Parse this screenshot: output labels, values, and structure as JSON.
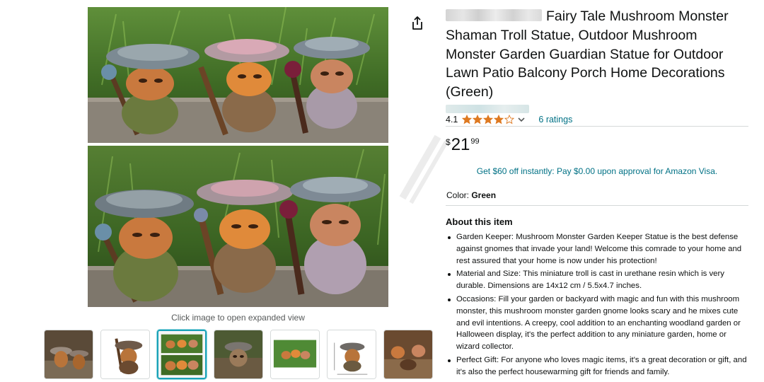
{
  "product": {
    "title": "Fairy Tale Mushroom Monster Shaman Troll Statue, Outdoor Mushroom Monster Garden Guardian Statue for Outdoor Lawn Patio Balcony Porch Home Decorations (Green)",
    "brand_redacted": true
  },
  "rating": {
    "value": "4.1",
    "stars_filled": 4.1,
    "stars_total": 5,
    "count_label": "6 ratings"
  },
  "price": {
    "symbol": "$",
    "whole": "21",
    "fraction": "99"
  },
  "promo": {
    "text": "Get $60 off instantly: Pay $0.00 upon approval for Amazon Visa."
  },
  "color": {
    "label": "Color: ",
    "value": "Green"
  },
  "about": {
    "heading": "About this item",
    "bullets": [
      "Garden Keeper: Mushroom Monster Garden Keeper Statue is the best defense against gnomes that invade your land! Welcome this comrade to your home and rest assured that your home is now under his protection!",
      "Material and Size: This miniature troll is cast in urethane resin which is very durable. Dimensions are 14x12 cm / 5.5x4.7 inches.",
      "Occasions: Fill your garden or backyard with magic and fun with this mushroom monster, this mushroom monster garden gnome looks scary and he mixes cute and evil intentions. A creepy, cool addition to an enchanting woodland garden or Halloween display, it's the perfect addition to any miniature garden, home or wizard collector.",
      "Perfect Gift: For anyone who loves magic items, it's a great decoration or gift, and it's also the perfect housewarming gift for friends and family."
    ]
  },
  "gallery": {
    "hint": "Click image to open expanded view",
    "thumbnail_count": 7,
    "active_index": 2
  },
  "icons": {
    "share": "share-icon",
    "star": "star-icon",
    "chevron": "chevron-down-icon"
  },
  "colors": {
    "link": "#007185",
    "star": "#de7921",
    "text": "#0f1111",
    "active_thumb": "#1aa2b7"
  }
}
